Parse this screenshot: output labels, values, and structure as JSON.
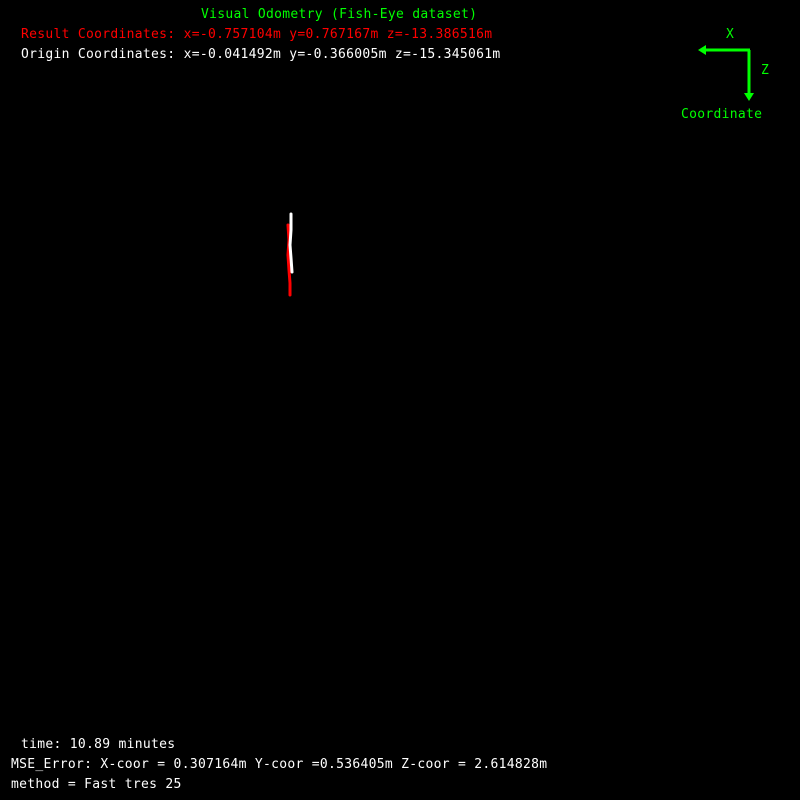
{
  "title": "Visual Odometry (Fish-Eye dataset)",
  "result": {
    "label": "Result Coordinates:",
    "x": "x=-0.757104m",
    "y": "y=0.767167m",
    "z": "z=-13.386516m"
  },
  "origin": {
    "label": "Origin Coordinates:",
    "x": "x=-0.041492m",
    "y": "y=-0.366005m",
    "z": "z=-15.345061m"
  },
  "axis_legend": {
    "x_label": "X",
    "z_label": "Z",
    "caption": "Coordinate",
    "color": "#00ff00"
  },
  "footer": {
    "time_label": "time:",
    "time_value": "10.89 minutes",
    "mse_label": "MSE_Error:",
    "mse_x": "X-coor = 0.307164m",
    "mse_y": "Y-coor =0.536405m",
    "mse_z": "Z-coor = 2.614828m",
    "method_label": "method =",
    "method_value": "Fast tres 25"
  },
  "colors": {
    "background": "#000000",
    "title": "#00ff00",
    "result": "#ff0000",
    "origin": "#ffffff",
    "footer": "#ffffff",
    "estimated_path": "#ff0000",
    "ground_truth_path": "#ffffff"
  }
}
